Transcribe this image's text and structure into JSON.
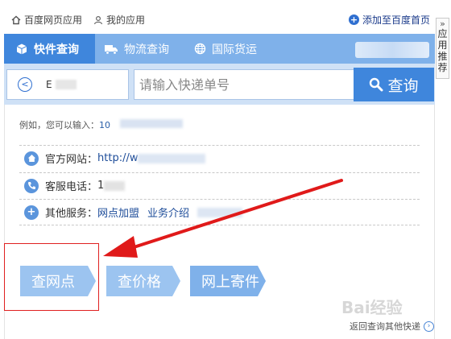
{
  "topbar": {
    "baidu_apps": "百度网页应用",
    "my_apps": "我的应用",
    "add_home": "添加至百度首页"
  },
  "sidetab": {
    "label": "应用推荐"
  },
  "tabs": [
    {
      "label": "快件查询",
      "icon": "cube-icon",
      "active": true
    },
    {
      "label": "物流查询",
      "icon": "truck-icon",
      "active": false
    },
    {
      "label": "国际货运",
      "icon": "globe-icon",
      "active": false
    }
  ],
  "search": {
    "company": "E",
    "placeholder": "请输入快递单号",
    "button": "查询"
  },
  "example": {
    "prefix": "例如，您可以输入：",
    "number": "10"
  },
  "info": {
    "website_label": "官方网站：",
    "website_value": "http://w",
    "phone_label": "客服电话：",
    "phone_value": "1",
    "services_label": "其他服务：",
    "services": [
      "网点加盟",
      "业务介绍"
    ]
  },
  "actions": [
    "查网点",
    "查价格",
    "网上寄件"
  ],
  "return_link": "返回查询其他快递",
  "watermark": "Bai经验",
  "colors": {
    "primary": "#3f86dc",
    "tab_bar": "#7fb1ea",
    "search_bg": "#cfe1f6",
    "highlight_red": "#e02020"
  }
}
